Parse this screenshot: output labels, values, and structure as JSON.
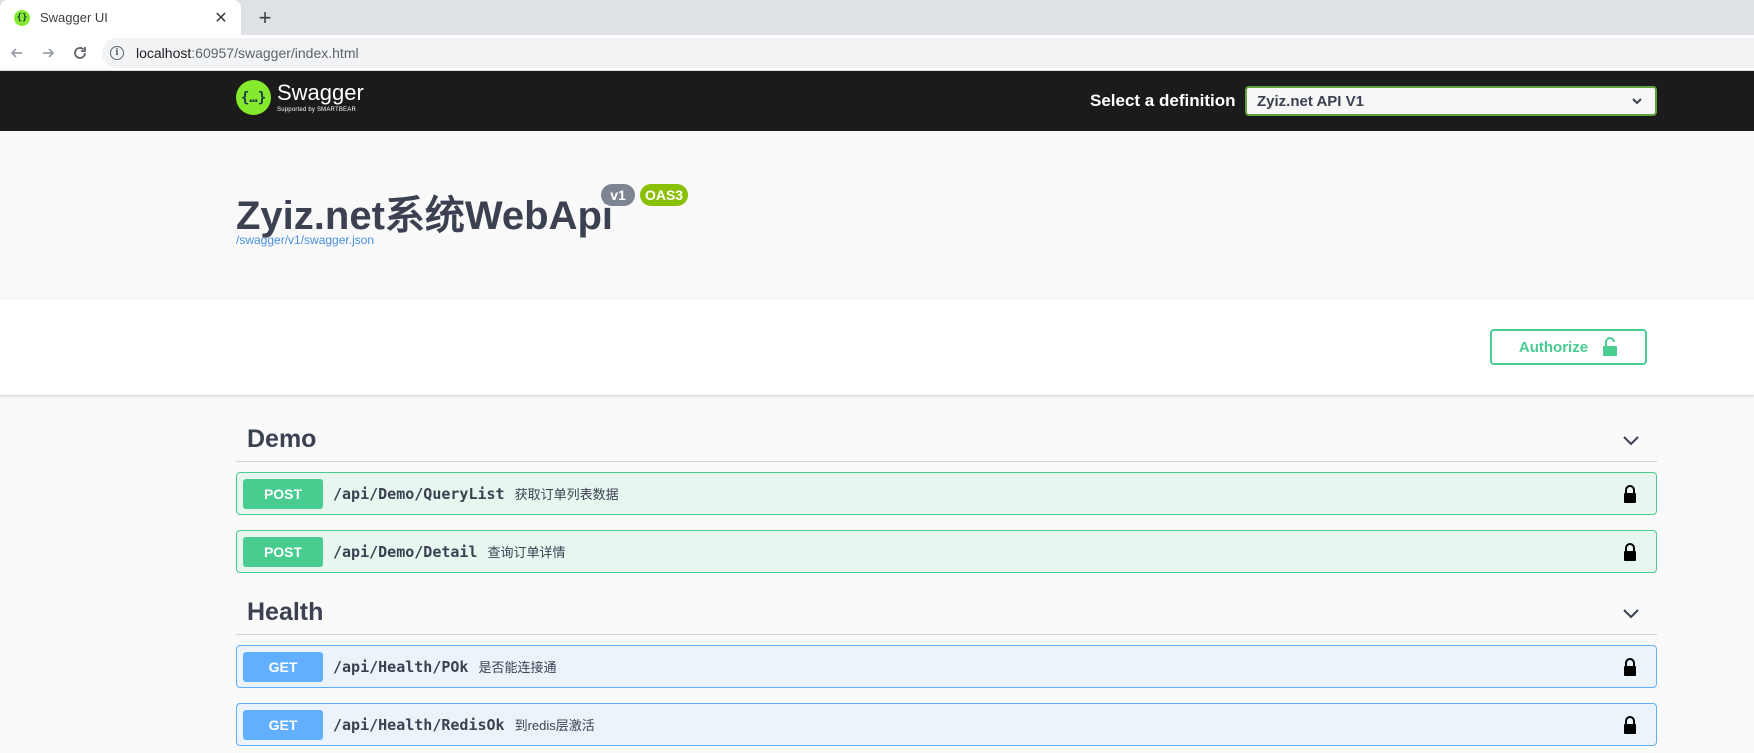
{
  "browser": {
    "tab_title": "Swagger UI",
    "tab_close": "✕",
    "new_tab": "+",
    "url_host": "localhost",
    "url_rest": ":60957/swagger/index.html"
  },
  "topbar": {
    "brand": "Swagger",
    "brand_sub": "Supported by SMARTBEAR",
    "definition_label": "Select a definition",
    "definition_value": "Zyiz.net API V1"
  },
  "info": {
    "title": "Zyiz.net系统WebApi",
    "version_badge": "v1",
    "oas_badge": "OAS3",
    "spec_url": "/swagger/v1/swagger.json"
  },
  "auth": {
    "authorize_label": "Authorize"
  },
  "sections": [
    {
      "name": "Demo",
      "operations": [
        {
          "method": "POST",
          "path": "/api/Demo/QueryList",
          "summary": "获取订单列表数据"
        },
        {
          "method": "POST",
          "path": "/api/Demo/Detail",
          "summary": "查询订单详情"
        }
      ]
    },
    {
      "name": "Health",
      "operations": [
        {
          "method": "GET",
          "path": "/api/Health/POk",
          "summary": "是否能连接通"
        },
        {
          "method": "GET",
          "path": "/api/Health/RedisOk",
          "summary": "到redis层激活"
        }
      ]
    }
  ],
  "colors": {
    "post": "#49cc90",
    "get": "#61affe",
    "topbar_bg": "#1b1b1b",
    "swagger_green": "#85ea2d"
  },
  "icons": {
    "lock": "lock-icon",
    "chevron": "chevron-down-icon"
  }
}
